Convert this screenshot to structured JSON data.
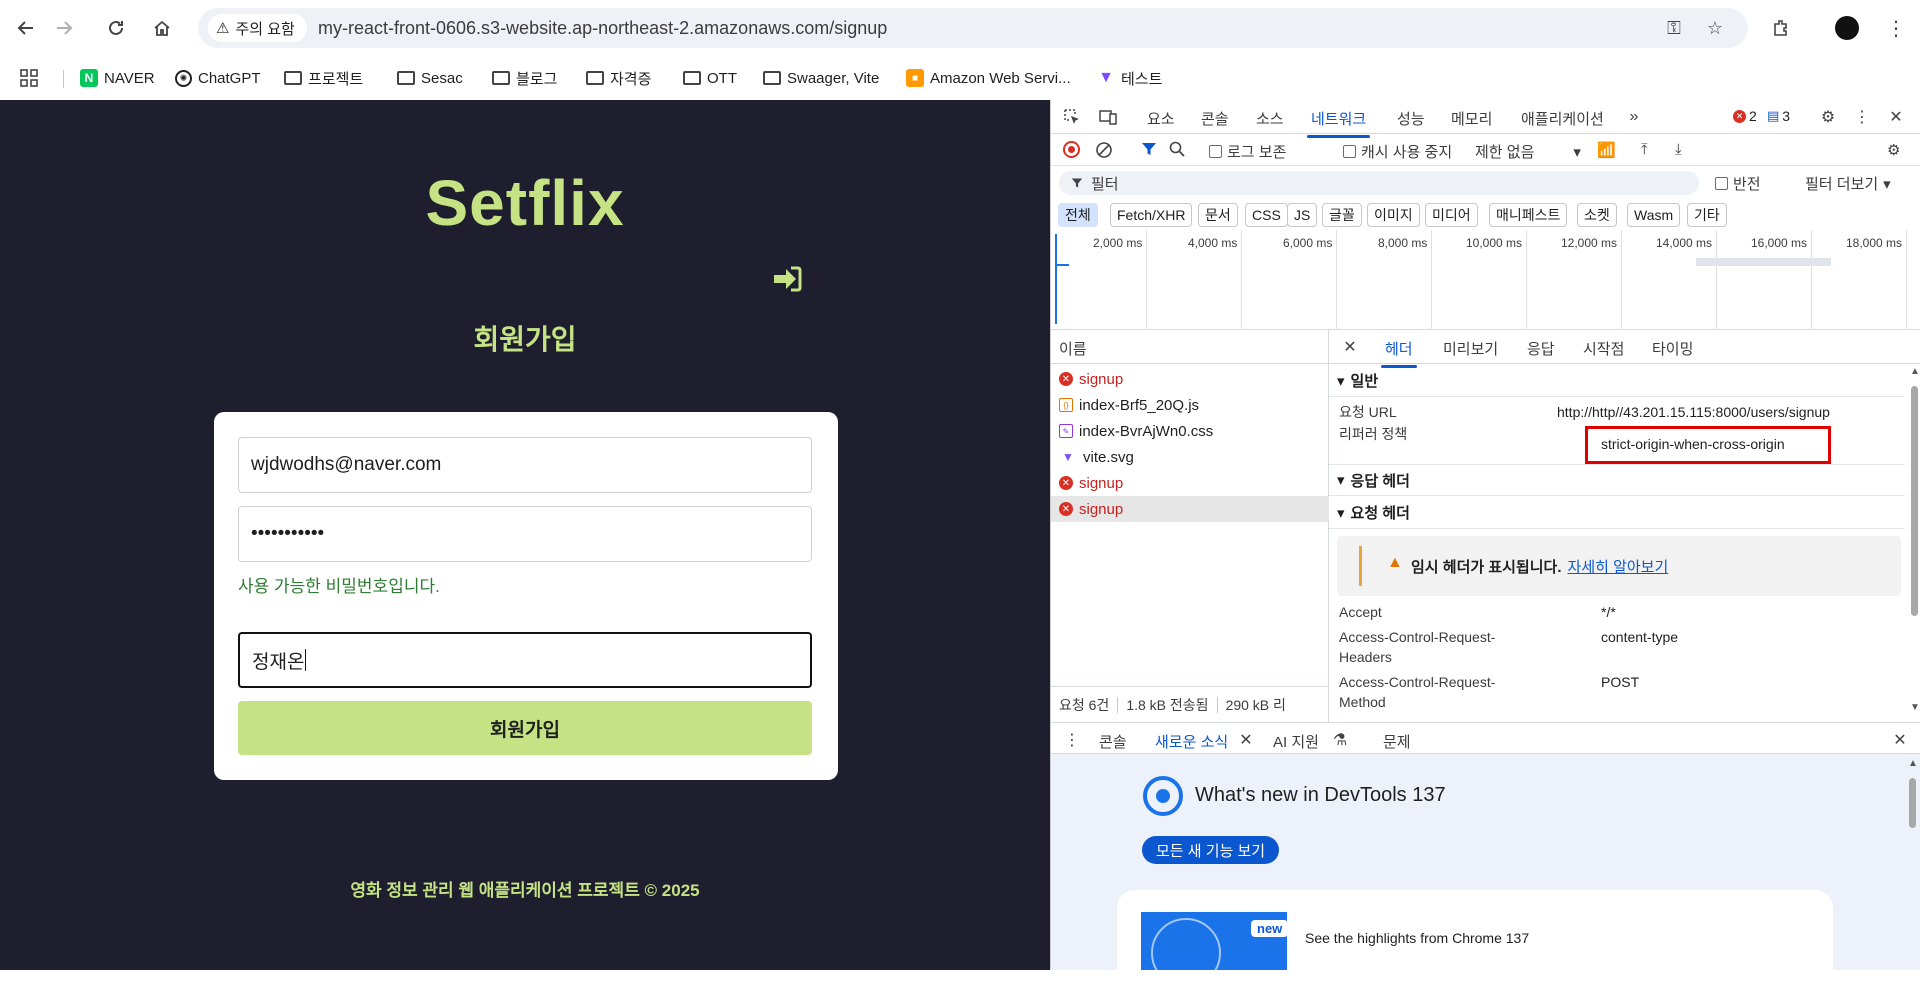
{
  "browser": {
    "security_label": "주의 요함",
    "url": "my-react-front-0606.s3-website.ap-northeast-2.amazonaws.com/signup",
    "bookmarks": [
      {
        "label": "NAVER",
        "icon": "naver-icon"
      },
      {
        "label": "ChatGPT",
        "icon": "chatgpt-icon"
      },
      {
        "label": "프로젝트",
        "icon": "folder-icon"
      },
      {
        "label": "Sesac",
        "icon": "folder-icon"
      },
      {
        "label": "블로그",
        "icon": "folder-icon"
      },
      {
        "label": "자격증",
        "icon": "folder-icon"
      },
      {
        "label": "OTT",
        "icon": "folder-icon"
      },
      {
        "label": "Swaager, Vite",
        "icon": "folder-icon"
      },
      {
        "label": "Amazon Web Servi...",
        "icon": "aws-icon"
      },
      {
        "label": "테스트",
        "icon": "vite-icon"
      }
    ]
  },
  "app": {
    "logo": "Setflix",
    "page_title": "회원가입",
    "email_value": "wjdwodhs@naver.com",
    "password_value": "•••••••••••",
    "password_hint": "사용 가능한 비밀번호입니다.",
    "name_value": "정재온",
    "submit_label": "회원가입",
    "footer": "영화 정보 관리 웹 애플리케이션 프로젝트 © 2025",
    "colors": {
      "background": "#1e1e2e",
      "accent": "#c5e384",
      "hint": "#2e7d32"
    }
  },
  "devtools": {
    "tabs": [
      "요소",
      "콘솔",
      "소스",
      "네트워크",
      "성능",
      "메모리",
      "애플리케이션"
    ],
    "selected_tab": "네트워크",
    "error_count": "2",
    "message_count": "3",
    "toolbar": {
      "preserve_log": "로그 보존",
      "disable_cache": "캐시 사용 중지",
      "throttle": "제한 없음"
    },
    "filter": {
      "placeholder": "필터",
      "invert": "반전",
      "more_filters": "필터 더보기"
    },
    "type_filters": [
      "전체",
      "Fetch/XHR",
      "문서",
      "CSS",
      "JS",
      "글꼴",
      "이미지",
      "미디어",
      "매니페스트",
      "소켓",
      "Wasm",
      "기타"
    ],
    "timeline_ticks": [
      "2,000 ms",
      "4,000 ms",
      "6,000 ms",
      "8,000 ms",
      "10,000 ms",
      "12,000 ms",
      "14,000 ms",
      "16,000 ms",
      "18,000 ms"
    ],
    "requests_header": "이름",
    "requests": [
      {
        "name": "signup",
        "type": "error"
      },
      {
        "name": "index-Brf5_20Q.js",
        "type": "js"
      },
      {
        "name": "index-BvrAjWn0.css",
        "type": "css"
      },
      {
        "name": "vite.svg",
        "type": "svg"
      },
      {
        "name": "signup",
        "type": "error"
      },
      {
        "name": "signup",
        "type": "error"
      }
    ],
    "status": {
      "requests": "요청 6건",
      "transferred": "1.8 kB 전송됨",
      "resources": "290 kB 리"
    },
    "detail_tabs": [
      "헤더",
      "미리보기",
      "응답",
      "시작점",
      "타이밍"
    ],
    "selected_detail_tab": "헤더",
    "general": {
      "section": "일반",
      "request_url_key": "요청 URL",
      "request_url_value": "http://http//43.201.15.115:8000/users/signup",
      "referrer_key": "리퍼러 정책",
      "referrer_value": "strict-origin-when-cross-origin"
    },
    "response_headers_section": "응답 헤더",
    "request_headers_section": "요청 헤더",
    "provisional_warning": "임시 헤더가 표시됩니다.",
    "learn_more": "자세히 알아보기",
    "request_headers": [
      {
        "key": "Accept",
        "value": "*/*"
      },
      {
        "key": "Access-Control-Request-Headers",
        "value": "content-type"
      },
      {
        "key": "Access-Control-Request-Method",
        "value": "POST"
      }
    ],
    "drawer_tabs": [
      "콘솔",
      "새로운 소식",
      "AI 지원",
      "문제"
    ],
    "selected_drawer_tab": "새로운 소식",
    "whats_new": {
      "title": "What's new in DevTools 137",
      "button": "모든 새 기능 보기",
      "badge": "new",
      "caption": "See the highlights from Chrome 137"
    }
  }
}
